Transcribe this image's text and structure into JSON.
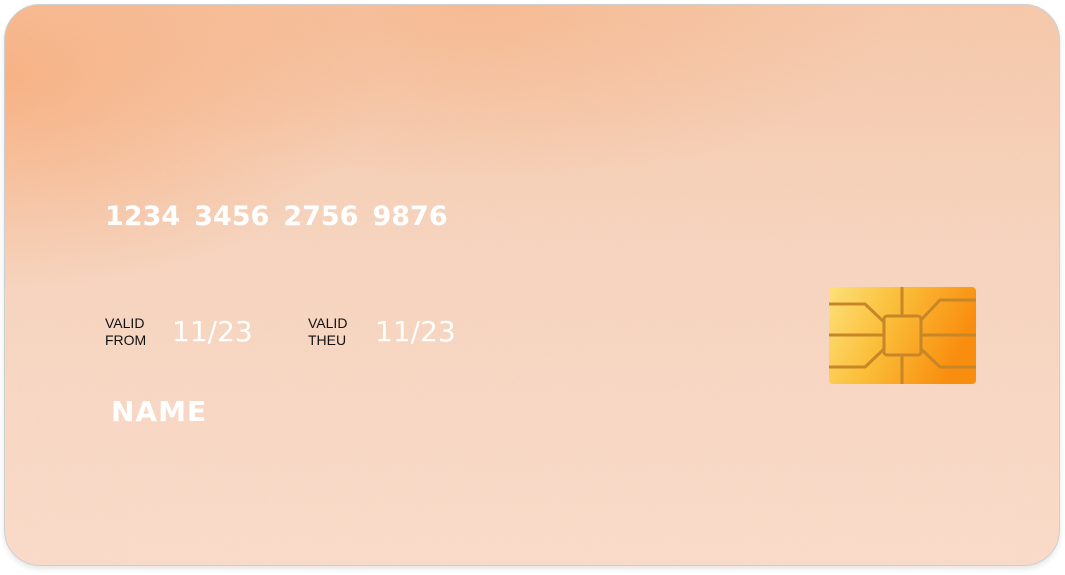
{
  "card": {
    "number_groups": [
      "1234",
      "3456",
      "2756",
      "9876"
    ],
    "valid_from": {
      "label_line1": "VALID",
      "label_line2": "FROM",
      "date": "11/23"
    },
    "valid_thru": {
      "label_line1": "VALID",
      "label_line2": "THEU",
      "date": "11/23"
    },
    "holder_name": "NAME",
    "chip_icon": "sim-chip-icon"
  },
  "colors": {
    "card_peach": "#f8d4bd",
    "card_orange_glow": "#faac78",
    "text_white": "#ffffff",
    "label_dark": "#111111",
    "chip_gold": "#fbbf3a",
    "chip_orange": "#f99a14",
    "chip_line": "#c78628"
  }
}
